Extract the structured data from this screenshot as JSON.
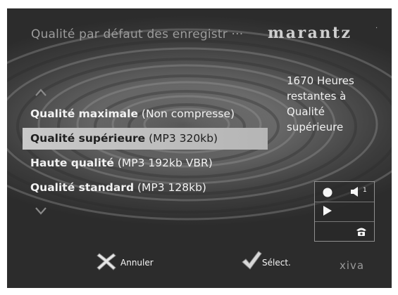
{
  "header": {
    "title": "Qualité par défaut des enregistr",
    "separator": "···",
    "brand": "marantz",
    "brand_mark": "·"
  },
  "menu": {
    "items": [
      {
        "bold": "Qualité maximale",
        "detail": " (Non compresse)",
        "selected": false
      },
      {
        "bold": "Qualité supérieure",
        "detail": " (MP3 320kb)",
        "selected": true
      },
      {
        "bold": "Haute qualité",
        "detail": " (MP3 192kb VBR)",
        "selected": false
      },
      {
        "bold": "Qualité standard",
        "detail": " (MP3 128kb)",
        "selected": false
      }
    ]
  },
  "info": {
    "lines": [
      "1670 Heures",
      "restantes à",
      "Qualité",
      "supérieure"
    ]
  },
  "status": {
    "volume_level": "1",
    "icons": [
      "record-icon",
      "speaker-icon",
      "play-icon",
      "phone-icon"
    ]
  },
  "footer": {
    "cancel_label": "Annuler",
    "select_label": "Sélect.",
    "logo": "xiva"
  },
  "colors": {
    "selected_bar": "#c4c4c4",
    "text": "#f2f2f2",
    "title": "#9c9c9c"
  }
}
